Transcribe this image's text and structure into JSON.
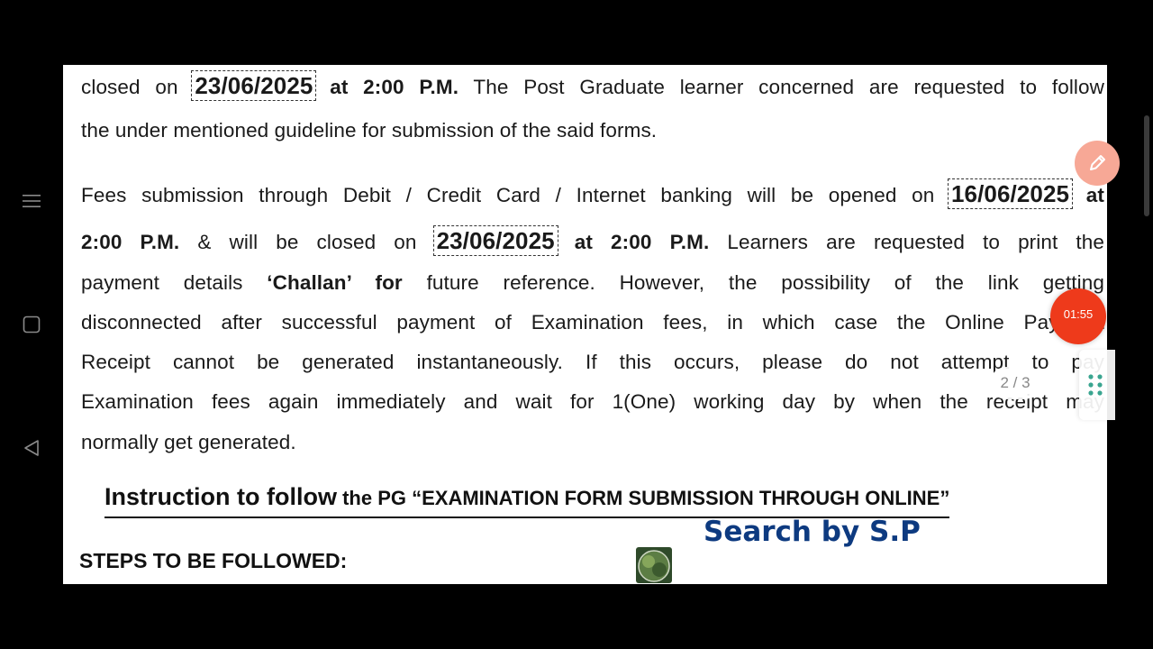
{
  "document": {
    "para1": {
      "l1_a": "closed on",
      "l1_date": "23/06/2025",
      "l1_b": "at 2:00 P.M.",
      "l1_c": "The Post Graduate learner concerned are requested to follow",
      "l2": "the under mentioned guideline for submission of the said forms."
    },
    "para2": {
      "l1_a": "Fees submission through Debit / Credit Card / Internet banking will be opened on",
      "l1_date": "16/06/2025",
      "l1_b": "at",
      "l2_a": "2:00 P.M.",
      "l2_b": "& will be closed on",
      "l2_date": "23/06/2025",
      "l2_c": "at 2:00 P.M.",
      "l2_d": "Learners are requested to print the",
      "l3_a": "payment details",
      "l3_b": "‘Challan’ for",
      "l3_c": "future reference. However, the possibility of the link getting",
      "l4": "disconnected after successful payment of Examination fees, in which case the Online Payment",
      "l5": "Receipt cannot be generated instantaneously. If this occurs, please do not attempt to pay",
      "l6": "Examination fees again immediately and wait for 1(One) working day by when the receipt may",
      "l7": "normally get generated."
    },
    "heading": {
      "big": "Instruction to follow",
      "small": " the PG “EXAMINATION FORM SUBMISSION THROUGH ONLINE”"
    },
    "steps_label": "STEPS TO BE FOLLOWED:"
  },
  "overlay": {
    "watermark": "Search by S.P",
    "timer": "01:55",
    "page_indicator": "2 / 3"
  },
  "colors": {
    "watermark": "#0d3a80",
    "timer_bubble": "#ee3a1b",
    "edit_fab": "#f7a896"
  },
  "icons": {
    "nav_menu": "menu-icon",
    "nav_recent": "square-icon",
    "nav_back": "back-triangle-icon",
    "edit": "pencil-icon",
    "grid": "grid-dots-icon"
  }
}
